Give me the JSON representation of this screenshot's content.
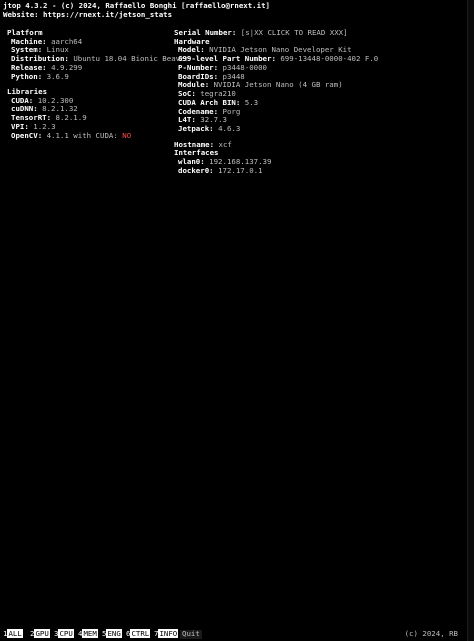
{
  "header": {
    "line1": "jtop 4.3.2 - (c) 2024, Raffaello Bonghi [raffaello@rnext.it]",
    "line2": "Website: https://rnext.it/jetson_stats"
  },
  "platform": {
    "title": "Platform",
    "rows": [
      {
        "label": "Machine:",
        "value": "aarch64"
      },
      {
        "label": "System:",
        "value": "Linux"
      },
      {
        "label": "Distribution:",
        "value": "Ubuntu 18.04 Bionic Beaver"
      },
      {
        "label": "Release:",
        "value": "4.9.299"
      },
      {
        "label": "Python:",
        "value": "3.6.9"
      }
    ]
  },
  "libraries": {
    "title": "Libraries",
    "rows": [
      {
        "label": "CUDA:",
        "value": "10.2.300"
      },
      {
        "label": "cuDNN:",
        "value": "8.2.1.32"
      },
      {
        "label": "TensorRT:",
        "value": "8.2.1.9"
      },
      {
        "label": "VPI:",
        "value": "1.2.3"
      }
    ],
    "opencv": {
      "label": "OpenCV:",
      "value": "4.1.1 with CUDA:",
      "cuda": "NO",
      "cuda_color": "#ff4a4a"
    }
  },
  "serial": {
    "label": "Serial Number:",
    "value": "[s|XX CLICK TO READ XXX]"
  },
  "hardware": {
    "title": "Hardware",
    "rows": [
      {
        "label": "Model:",
        "value": "NVIDIA Jetson Nano Developer Kit"
      },
      {
        "label": "699-level Part Number:",
        "value": "699-13448-0000-402 F.0"
      },
      {
        "label": "P-Number:",
        "value": "p3448-0000"
      },
      {
        "label": "BoardIDs:",
        "value": "p3448"
      },
      {
        "label": "Module:",
        "value": "NVIDIA Jetson Nano (4 GB ram)"
      },
      {
        "label": "SoC:",
        "value": "tegra210"
      },
      {
        "label": "CUDA Arch BIN:",
        "value": "5.3"
      },
      {
        "label": "Codename:",
        "value": "Porg"
      },
      {
        "label": "L4T:",
        "value": "32.7.3"
      },
      {
        "label": "Jetpack:",
        "value": "4.6.3"
      }
    ]
  },
  "network": {
    "hostname_label": "Hostname:",
    "hostname": "xcf",
    "interfaces_title": "Interfaces",
    "interfaces": [
      {
        "label": "wlan0:",
        "value": "192.168.137.39"
      },
      {
        "label": "docker0:",
        "value": "172.17.0.1"
      }
    ]
  },
  "footer": {
    "tabs": [
      {
        "num": "1",
        "label": "ALL"
      },
      {
        "num": "2",
        "label": "GPU"
      },
      {
        "num": "3",
        "label": "CPU"
      },
      {
        "num": "4",
        "label": "MEM"
      },
      {
        "num": "5",
        "label": "ENG"
      },
      {
        "num": "6",
        "label": "CTRL"
      },
      {
        "num": "7",
        "label": "INFO"
      }
    ],
    "quit": "Quit",
    "copyright": "(c) 2024, RB"
  }
}
